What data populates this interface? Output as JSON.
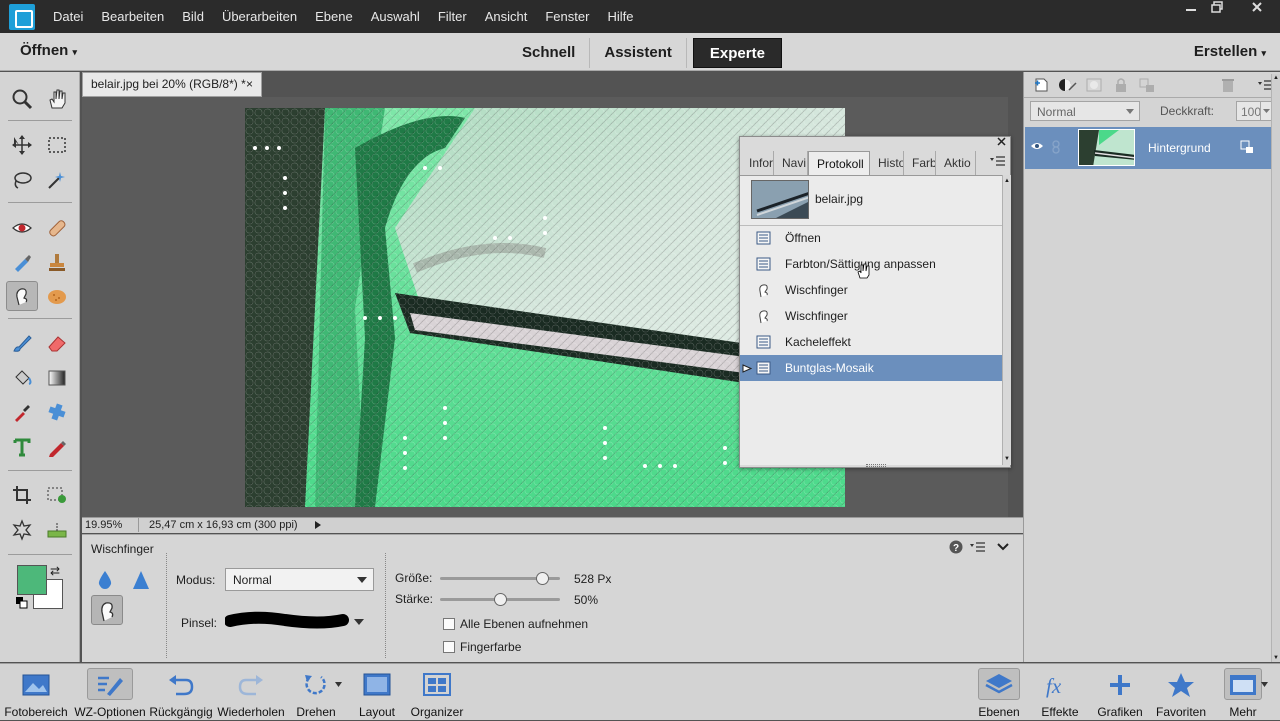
{
  "menubar": {
    "items": [
      "Datei",
      "Bearbeiten",
      "Bild",
      "Überarbeiten",
      "Ebene",
      "Auswahl",
      "Filter",
      "Ansicht",
      "Fenster",
      "Hilfe"
    ]
  },
  "modebar": {
    "open_label": "Öffnen",
    "tabs": [
      "Schnell",
      "Assistent",
      "Experte"
    ],
    "active_tab": "Experte",
    "create_label": "Erstellen"
  },
  "document": {
    "tab_title": "belair.jpg bei 20% (RGB/8*) *",
    "close_glyph": "×",
    "zoom": "19.95%",
    "doc_size": "25,47 cm x 16,93 cm (300 ppi)"
  },
  "history_panel": {
    "tabs": [
      "Infor",
      "Navi",
      "Protokoll",
      "Histo",
      "Farbf",
      "Aktio"
    ],
    "active_tab": "Protokoll",
    "snapshot_name": "belair.jpg",
    "steps": [
      "Öffnen",
      "Farbton/Sättigung anpassen",
      "Wischfinger",
      "Wischfinger",
      "Kacheleffekt",
      "Buntglas-Mosaik"
    ],
    "selected_step": "Buntglas-Mosaik"
  },
  "layers_panel": {
    "blend_mode": "Normal",
    "opacity_label": "Deckkraft:",
    "opacity_value": "100%",
    "layer_name": "Hintergrund"
  },
  "tool_options": {
    "tool_name": "Wischfinger",
    "mode_label": "Modus:",
    "mode_value": "Normal",
    "brush_label": "Pinsel:",
    "size_label": "Größe:",
    "size_value": "528 Px",
    "size_level": 0.85,
    "strength_label": "Stärke:",
    "strength_value": "50%",
    "strength_level": 0.5,
    "sample_all_label": "Alle Ebenen aufnehmen",
    "finger_paint_label": "Fingerfarbe"
  },
  "taskbar": {
    "left": [
      "Fotobereich",
      "WZ-Optionen",
      "Rückgängig",
      "Wiederholen",
      "Drehen",
      "Layout",
      "Organizer"
    ],
    "right": [
      "Ebenen",
      "Effekte",
      "Grafiken",
      "Favoriten",
      "Mehr"
    ]
  },
  "colors": {
    "foreground": "#4db87a",
    "background": "#ffffff",
    "selection": "#6b8fbd",
    "dark_ui": "#2b2b2b"
  }
}
